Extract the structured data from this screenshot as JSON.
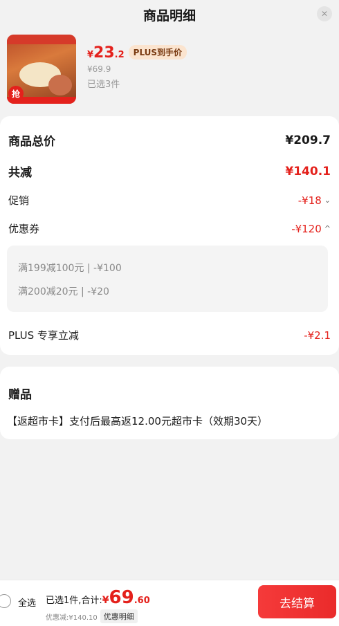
{
  "header": {
    "title": "商品明细",
    "close_icon": "close-icon"
  },
  "product": {
    "price_currency": "¥",
    "price_int": "23",
    "price_dec": ".2",
    "plus_badge": "PLUS到手价",
    "original_price": "¥69.9",
    "selected_count": "已选3件",
    "image_badge": "抢"
  },
  "summary": {
    "total_label": "商品总价",
    "total_value": "¥209.7",
    "reduction_label": "共减",
    "reduction_value": "¥140.1",
    "promo_label": "促销",
    "promo_value": "-¥18",
    "coupon_label": "优惠券",
    "coupon_value": "-¥120",
    "coupons": [
      "满199减100元 | -¥100",
      "满200减20元 | -¥20"
    ],
    "plus_label": "PLUS 专享立减",
    "plus_value": "-¥2.1"
  },
  "gift": {
    "title": "赠品",
    "text": "【返超市卡】支付后最高返12.00元超市卡（效期30天）"
  },
  "bottom": {
    "select_all": "全选",
    "total_prefix": "已选1件,合计:",
    "total_currency": "¥",
    "total_int": "69",
    "total_dec": ".60",
    "discount_text": "优惠减:¥140.10",
    "detail_button": "优惠明细",
    "checkout_button": "去结算"
  },
  "colors": {
    "accent": "#e4211c",
    "badge_bg": "#fbe4cf"
  }
}
